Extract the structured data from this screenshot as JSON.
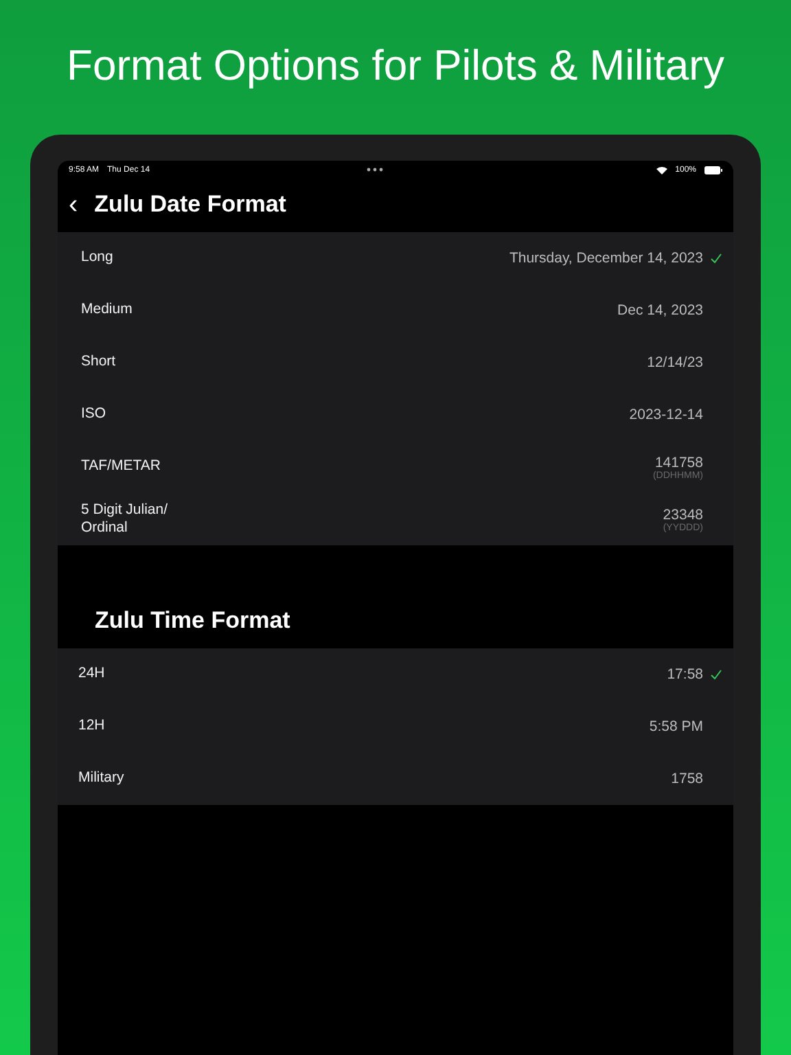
{
  "headline": "Format Options for Pilots & Military",
  "status_bar": {
    "time": "9:58 AM",
    "date": "Thu Dec 14",
    "battery": "100%"
  },
  "nav": {
    "back": "‹",
    "title": "Zulu Date Format"
  },
  "date_formats": [
    {
      "label": "Long",
      "value": "Thursday, December 14, 2023",
      "selected": true
    },
    {
      "label": "Medium",
      "value": "Dec 14, 2023",
      "selected": false
    },
    {
      "label": "Short",
      "value": "12/14/23",
      "selected": false
    },
    {
      "label": "ISO",
      "value": "2023-12-14",
      "selected": false
    },
    {
      "label": "TAF/METAR",
      "value": "141758",
      "hint": "(DDHHMM)",
      "selected": false
    },
    {
      "label": "5 Digit Julian/ Ordinal",
      "value": "23348",
      "hint": "(YYDDD)",
      "selected": false
    }
  ],
  "time_section": {
    "title": "Zulu Time Format"
  },
  "time_formats": [
    {
      "label": "24H",
      "value": "17:58",
      "selected": true
    },
    {
      "label": "12H",
      "value": "5:58 PM",
      "selected": false
    },
    {
      "label": "Military",
      "value": "1758",
      "selected": false
    }
  ]
}
